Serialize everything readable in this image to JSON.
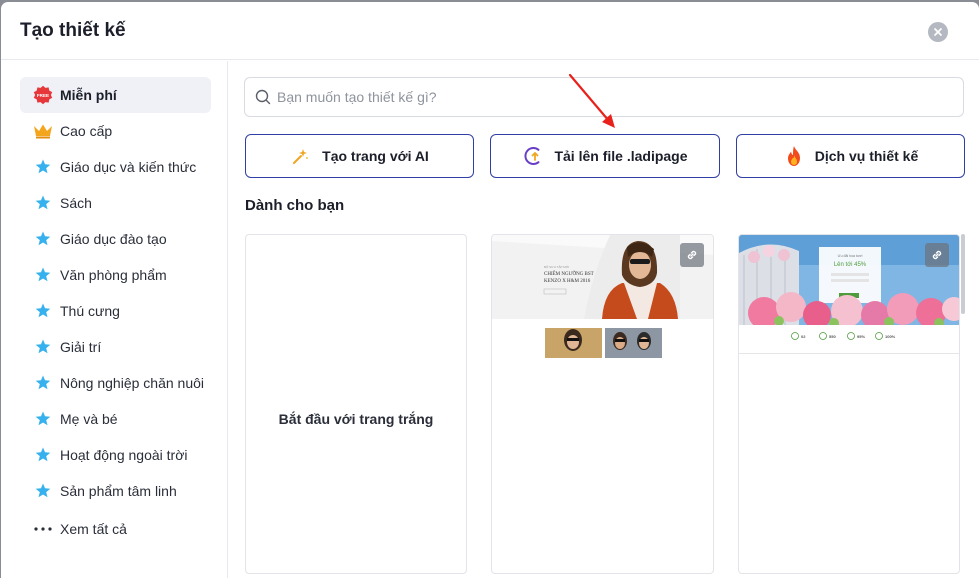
{
  "modal": {
    "title": "Tạo thiết kế",
    "close_icon": "close-icon"
  },
  "sidebar": {
    "items": [
      {
        "label": "Miễn phí",
        "icon": "free-badge-icon",
        "badge": "FREE",
        "active": true
      },
      {
        "label": "Cao cấp",
        "icon": "crown-icon"
      },
      {
        "label": "Giáo dục và kiến thức",
        "icon": "star-icon"
      },
      {
        "label": "Sách",
        "icon": "star-icon"
      },
      {
        "label": "Giáo dục đào tạo",
        "icon": "star-icon"
      },
      {
        "label": "Văn phòng phẩm",
        "icon": "star-icon"
      },
      {
        "label": "Thú cưng",
        "icon": "star-icon"
      },
      {
        "label": "Giải trí",
        "icon": "star-icon"
      },
      {
        "label": "Nông nghiệp chăn nuôi",
        "icon": "star-icon"
      },
      {
        "label": "Mẹ và bé",
        "icon": "star-icon"
      },
      {
        "label": "Hoạt động ngoài trời",
        "icon": "star-icon"
      },
      {
        "label": "Sản phẩm tâm linh",
        "icon": "star-icon"
      },
      {
        "label": "Xem tất cả",
        "icon": "more-dots-icon"
      }
    ]
  },
  "search": {
    "placeholder": "Bạn muốn tạo thiết kế gì?",
    "value": ""
  },
  "actions": [
    {
      "label": "Tạo trang với AI",
      "icon": "sparkle-wand-icon"
    },
    {
      "label": "Tải lên file .ladipage",
      "icon": "upload-icon"
    },
    {
      "label": "Dịch vụ thiết kế",
      "icon": "fire-icon"
    }
  ],
  "section": {
    "title": "Dành cho bạn"
  },
  "templates": {
    "blank_label": "Bắt đầu với trang trắng",
    "fashion": {
      "subtitle": "BỘ SƯU TẬP MỚI",
      "headline_1": "CHIÊM NGƯỠNG BST",
      "headline_2": "KENZO X H&M 2016"
    },
    "flower": {
      "heading": "Lên tới 45%",
      "subheading": "Ưu đãi hoa tươi",
      "stats": [
        "02",
        "550",
        "95%",
        "100%"
      ]
    }
  },
  "colors": {
    "accent": "#2f3fa6",
    "annotation_arrow": "#e8221b",
    "free_badge": "#e6373b",
    "star": "#36b1ee",
    "crown": "#f3a61d"
  }
}
